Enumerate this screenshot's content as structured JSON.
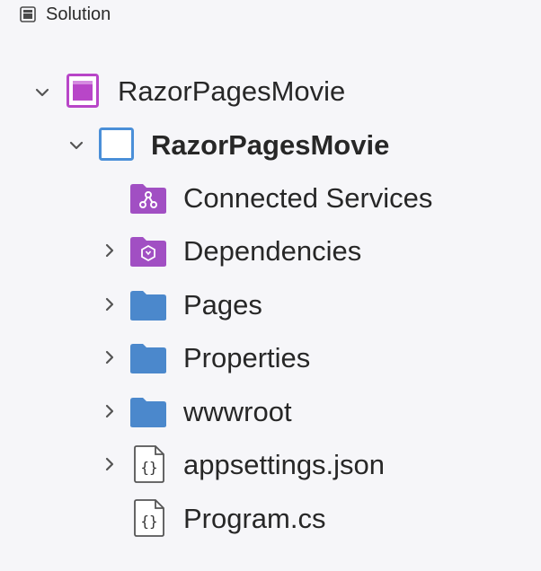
{
  "header": {
    "title": "Solution",
    "icon": "solution-panel-icon"
  },
  "tree": {
    "solution": {
      "label": "RazorPagesMovie",
      "icon": "solution-icon",
      "expanded": true
    },
    "project": {
      "label": "RazorPagesMovie",
      "icon": "project-icon",
      "expanded": true
    },
    "items": [
      {
        "label": "Connected Services",
        "icon": "connected-services-icon",
        "expandable": false
      },
      {
        "label": "Dependencies",
        "icon": "dependencies-icon",
        "expandable": true,
        "expanded": false
      },
      {
        "label": "Pages",
        "icon": "folder-icon",
        "expandable": true,
        "expanded": false
      },
      {
        "label": "Properties",
        "icon": "folder-icon",
        "expandable": true,
        "expanded": false
      },
      {
        "label": "wwwroot",
        "icon": "folder-icon",
        "expandable": true,
        "expanded": false
      },
      {
        "label": "appsettings.json",
        "icon": "json-file-icon",
        "expandable": true,
        "expanded": false
      },
      {
        "label": "Program.cs",
        "icon": "cs-file-icon",
        "expandable": false
      }
    ]
  },
  "colors": {
    "background": "#f6f6f9",
    "solution_accent": "#b846c8",
    "project_accent": "#4a8fd8",
    "folder": "#4b88cc",
    "special_folder": "#a14fc3",
    "text": "#272727"
  }
}
